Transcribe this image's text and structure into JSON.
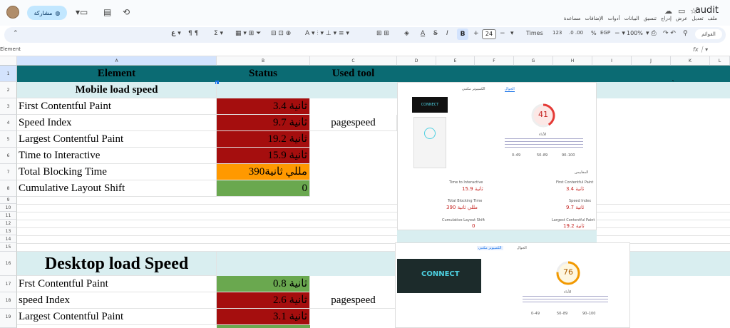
{
  "title": {
    "doc": "audit",
    "menus": [
      "ملف",
      "تعديل",
      "عرض",
      "إدراج",
      "تنسيق",
      "البيانات",
      "أدوات",
      "الإضافات",
      "مساعدة"
    ],
    "share": "مشاركة"
  },
  "toolbar": {
    "zoom": "100%",
    "currency": "EGP",
    "percent": "%",
    "font": "Times",
    "number_fmt": "123",
    "font_size": "24"
  },
  "namebox": "Element",
  "columns": [
    "A",
    "B",
    "C",
    "D",
    "E",
    "F",
    "G",
    "H",
    "I",
    "J",
    "K",
    "L"
  ],
  "rows": [
    "1",
    "2",
    "3",
    "4",
    "5",
    "6",
    "7",
    "8",
    "9",
    "10",
    "11",
    "12",
    "13",
    "14",
    "15",
    "16",
    "17",
    "18",
    "19"
  ],
  "header": {
    "element": "Element",
    "status": "Status",
    "tool": "Used tool"
  },
  "mobile": {
    "title": "Mobile load speed",
    "tool": "pagespeed",
    "items": [
      {
        "name": "First Contentful Paint",
        "value": "3.4 ثانية"
      },
      {
        "name": "Speed Index",
        "value": "9.7 ثانية"
      },
      {
        "name": "Largest Contentful Paint",
        "value": "19.2 ثانية"
      },
      {
        "name": "Time to Interactive",
        "value": "15.9 ثانية"
      },
      {
        "name": "Total Blocking Time",
        "value": "390مللي ثانية"
      },
      {
        "name": "Cumulative Layout Shift",
        "value": "0"
      }
    ]
  },
  "desktop": {
    "title": "Desktop load Speed",
    "tool": "pagespeed",
    "items": [
      {
        "name": "Frst Contentful Paint",
        "value": "0.8 ثانية"
      },
      {
        "name": "speed Index",
        "value": "2.6 ثانية"
      },
      {
        "name": "Largest Contentful Paint",
        "value": "3.1 ثانية"
      }
    ]
  },
  "shot1": {
    "tab_mobile": "الجوال",
    "tab_desktop": "الكمبيوتر مكتبي",
    "score": "41",
    "perf": "الأداء",
    "metrics_label": "المقاييس",
    "m": [
      {
        "n": "First Contentful Paint",
        "v": "3.4 ثانية"
      },
      {
        "n": "Time to Interactive",
        "v": "15.9 ثانية"
      },
      {
        "n": "Speed Index",
        "v": "9.7 ثانية"
      },
      {
        "n": "Total Blocking Time",
        "v": "390 مللي ثانية"
      },
      {
        "n": "Largest Contentful Paint",
        "v": "19.2 ثانية"
      },
      {
        "n": "Cumulative Layout Shift",
        "v": "0"
      }
    ],
    "legend": [
      "0–49",
      "50–89",
      "90–100"
    ],
    "site": "CONNECT"
  },
  "shot2": {
    "tab_mobile": "الجوال",
    "tab_desktop": "الكمبيوتر مكتبي",
    "score": "76",
    "perf": "الأداء",
    "legend": [
      "0–49",
      "50–89",
      "90–100"
    ],
    "site": "CONNECT"
  },
  "colors": {
    "teal": "#0b6b73",
    "pale": "#d9eef0",
    "red": "#a50e0e",
    "orange": "#ff9900",
    "green": "#6aa84f"
  }
}
